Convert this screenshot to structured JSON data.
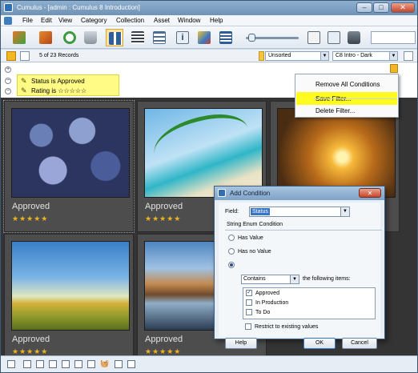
{
  "window": {
    "title": "Cumulus - [admin : Cumulus 8 Introduction]",
    "min_label": "–",
    "max_label": "□",
    "close_label": "✕"
  },
  "menu": {
    "items": [
      "File",
      "Edit",
      "View",
      "Category",
      "Collection",
      "Asset",
      "Window",
      "Help"
    ]
  },
  "toolbar": {
    "icons": [
      "open-collection-icon",
      "export-icon",
      "refresh-icon",
      "trash-icon",
      "thumbnail-view-icon",
      "list-view-icon",
      "details-view-icon",
      "info-icon",
      "preview-icon",
      "report-icon",
      "zoom-slider",
      "properties-icon",
      "preview-window-icon",
      "camera-icon"
    ],
    "colors": {
      "selected_bg": "#fde3a4"
    }
  },
  "filterbar": {
    "records": "5 of 23 Records",
    "sort_label": "Unsorted",
    "view_label": "C8 Intro - Dark"
  },
  "conditions": [
    {
      "field": "Status",
      "text": "Status is Approved"
    },
    {
      "field": "Rating",
      "text": "Rating is ☆☆☆☆☆"
    }
  ],
  "assets": [
    {
      "status": "Approved",
      "rating": "★★★★★",
      "scene": "pebbles"
    },
    {
      "status": "Approved",
      "rating": "★★★★★",
      "scene": "palm-beach"
    },
    {
      "status": "",
      "rating": "",
      "scene": "sunset-field"
    },
    {
      "status": "Approved",
      "rating": "★★★★★",
      "scene": "meadow-sky"
    },
    {
      "status": "Approved",
      "rating": "★★★★★",
      "scene": "mountain-lake"
    }
  ],
  "context_menu": {
    "items": [
      {
        "label": "Remove All Conditions",
        "highlighted": false
      },
      {
        "label": "Save Filter...",
        "highlighted": true
      },
      {
        "label": "Delete Filter...",
        "highlighted": false
      }
    ]
  },
  "dialog": {
    "title": "Add Condition",
    "close_label": "✕",
    "field_label": "Field:",
    "field_value": "Status",
    "section_label": "String Enum Condition",
    "options": [
      "Has Value",
      "Has no Value",
      "Contains"
    ],
    "selected_option": "Contains",
    "contains_value": "Contains",
    "following_label": "the following items:",
    "items": [
      {
        "label": "Approved",
        "checked": true
      },
      {
        "label": "In Production",
        "checked": false
      },
      {
        "label": "To Do",
        "checked": false
      }
    ],
    "restrict_label": "Restrict to existing values",
    "restrict_checked": false,
    "help_label": "Help",
    "ok_label": "OK",
    "cancel_label": "Cancel"
  }
}
